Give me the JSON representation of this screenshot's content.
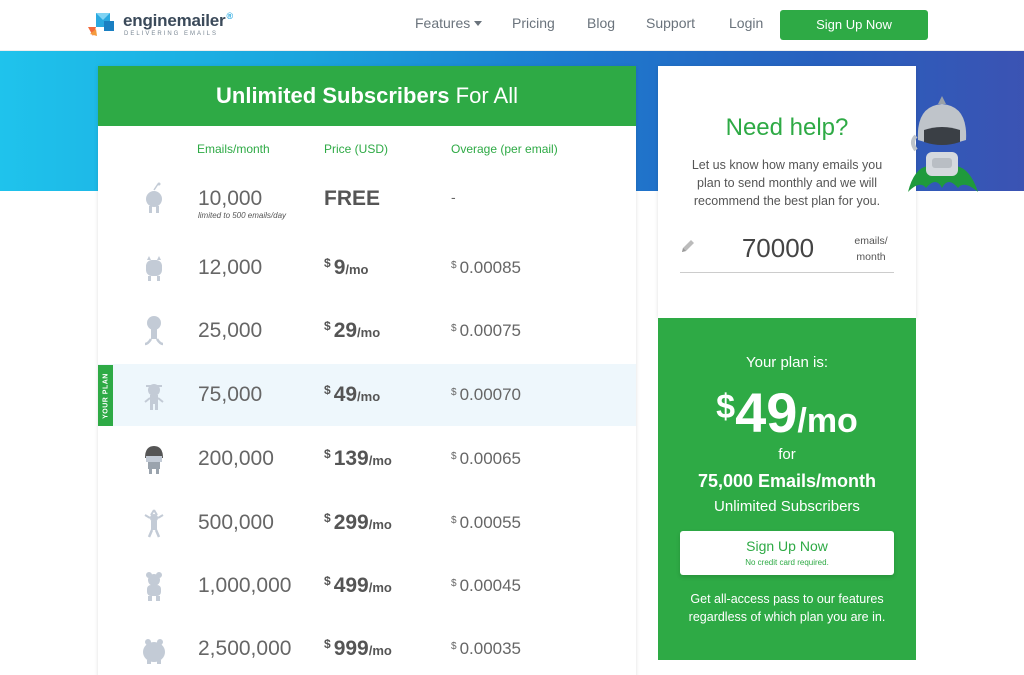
{
  "header": {
    "brand": "enginemailer",
    "brand_mark": "®",
    "tagline": "DELIVERING EMAILS",
    "nav": {
      "features": "Features",
      "pricing": "Pricing",
      "blog": "Blog",
      "support": "Support",
      "login": "Login"
    },
    "signup": "Sign Up Now"
  },
  "pricing": {
    "title_bold": "Unlimited Subscribers",
    "title_rest": "For All",
    "columns": {
      "emails": "Emails/month",
      "price": "Price (USD)",
      "overage": "Overage (per email)"
    },
    "currency_symbol": "$",
    "per_month": "/mo",
    "your_plan_label": "YOUR PLAN",
    "rows": [
      {
        "emails": "10,000",
        "note": "limited to 500 emails/day",
        "price": "FREE",
        "overage": "-"
      },
      {
        "emails": "12,000",
        "price": "9",
        "overage": "0.00085"
      },
      {
        "emails": "25,000",
        "price": "29",
        "overage": "0.00075"
      },
      {
        "emails": "75,000",
        "price": "49",
        "overage": "0.00070"
      },
      {
        "emails": "200,000",
        "price": "139",
        "overage": "0.00065"
      },
      {
        "emails": "500,000",
        "price": "299",
        "overage": "0.00055"
      },
      {
        "emails": "1,000,000",
        "price": "499",
        "overage": "0.00045"
      },
      {
        "emails": "2,500,000",
        "price": "999",
        "overage": "0.00035"
      }
    ]
  },
  "help": {
    "title": "Need help?",
    "description": "Let us know how many emails you plan to send monthly and we will recommend the best plan for you.",
    "input_value": "70000",
    "unit_line1": "emails/",
    "unit_line2": "month"
  },
  "plan": {
    "intro": "Your plan is:",
    "currency": "$",
    "amount": "49",
    "per": "/mo",
    "for": "for",
    "volume": "75,000 Emails/month",
    "subscribers": "Unlimited Subscribers",
    "button_label": "Sign Up Now",
    "button_note": "No credit card required.",
    "note": "Get all-access pass to our features regardless of which plan you are in."
  },
  "colors": {
    "brand_green": "#2eaa45",
    "row_highlight": "#eef7fc",
    "icon_gray": "#c3cbd6"
  },
  "icons": {
    "logo": "envelope-cube-logo",
    "edit": "pencil-icon",
    "mascot": "robot-mascot-illustration",
    "plan_avatars": [
      "one-eyed-monster",
      "alien-monster",
      "stick-figure",
      "antenna-robot",
      "helmet-robot",
      "dancing-sprout",
      "bear-figure",
      "blob-monster"
    ]
  }
}
